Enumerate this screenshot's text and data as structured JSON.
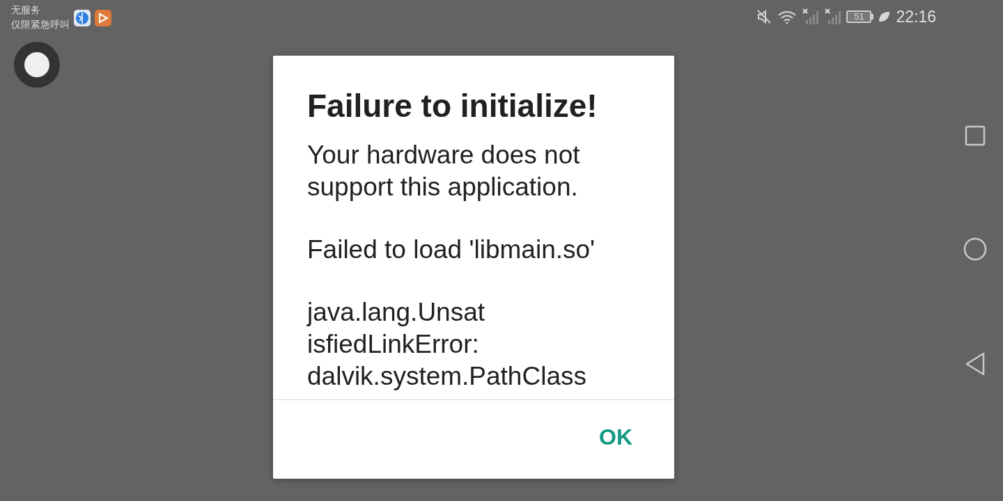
{
  "status_bar": {
    "carrier_lines": [
      "无服务",
      "仅限紧急呼叫"
    ],
    "battery": "51",
    "time": "22:16"
  },
  "dialog": {
    "title": "Failure to initialize!",
    "paragraphs": [
      {
        "lines": [
          "Your hardware does not",
          "support this application."
        ]
      },
      {
        "lines": [
          "Failed to load 'libmain.so'"
        ]
      },
      {
        "lines": [
          "java.lang.Unsat",
          "isfiedLinkError:",
          "dalvik.system.PathClass"
        ]
      }
    ],
    "buttons": [
      {
        "label": "OK"
      }
    ]
  }
}
